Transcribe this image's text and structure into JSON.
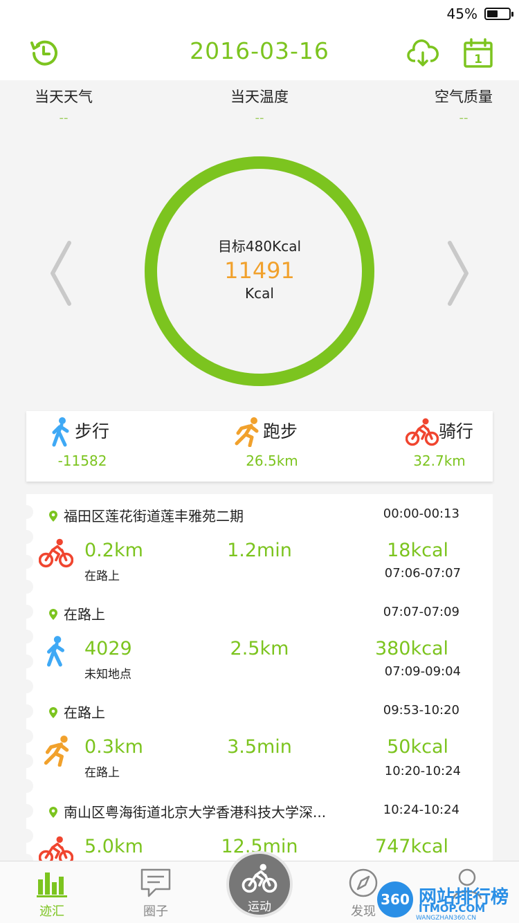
{
  "status": {
    "battery": "45%",
    "battery_level": 0.45
  },
  "header": {
    "date": "2016-03-16",
    "left_icon": "history-clock-icon",
    "cloud_icon": "cloud-download-icon",
    "calendar_icon": "calendar-icon",
    "calendar_day": "1"
  },
  "weather": [
    {
      "label": "当天天气",
      "value": "--"
    },
    {
      "label": "当天温度",
      "value": "--"
    },
    {
      "label": "空气质量",
      "value": "--"
    }
  ],
  "ring": {
    "goal": "目标480Kcal",
    "value": "11491",
    "unit": "Kcal",
    "progress": 1.0
  },
  "summary": [
    {
      "label": "步行",
      "value": "-11582",
      "icon": "walk-icon",
      "color": "#3fa9f5"
    },
    {
      "label": "跑步",
      "value": "26.5km",
      "icon": "run-icon",
      "color": "#f1a12c"
    },
    {
      "label": "骑行",
      "value": "32.7km",
      "icon": "bike-icon",
      "color": "#f0452f"
    }
  ],
  "timeline": [
    {
      "location": "福田区莲花街道莲丰雅苑二期",
      "loc_time": "00:00-00:13",
      "activity": "bike",
      "main": "0.2km",
      "sub": "在路上",
      "mid": "1.2min",
      "right": "18kcal",
      "act_time": "07:06-07:07"
    },
    {
      "location": "在路上",
      "loc_time": "07:07-07:09",
      "activity": "walk",
      "main": "4029",
      "sub": "未知地点",
      "mid": "2.5km",
      "right": "380kcal",
      "act_time": "07:09-09:04"
    },
    {
      "location": "在路上",
      "loc_time": "09:53-10:20",
      "activity": "run",
      "main": "0.3km",
      "sub": "在路上",
      "mid": "3.5min",
      "right": "50kcal",
      "act_time": "10:20-10:24"
    },
    {
      "location": "南山区粤海街道北京大学香港科技大学深...",
      "loc_time": "10:24-10:24",
      "activity": "bike",
      "main": "5.0km",
      "sub": "",
      "mid": "12.5min",
      "right": "747kcal",
      "act_time": ""
    }
  ],
  "tabs": [
    {
      "label": "迹汇",
      "icon": "bar-chart-icon",
      "active": true
    },
    {
      "label": "圈子",
      "icon": "chat-icon",
      "active": false
    },
    {
      "label": "运动",
      "icon": "bike-icon",
      "active": false
    },
    {
      "label": "发现",
      "icon": "compass-icon",
      "active": false
    },
    {
      "label": "",
      "icon": "profile-icon",
      "active": false
    }
  ],
  "watermark": {
    "logo": "360",
    "title": "网站排行榜",
    "subtitle": "ITMOP.COM",
    "url": "WANGZHAN360.CN"
  },
  "colors": {
    "accent": "#7cc41f",
    "orange": "#f1a12c",
    "red": "#f0452f",
    "blue": "#3fa9f5"
  }
}
